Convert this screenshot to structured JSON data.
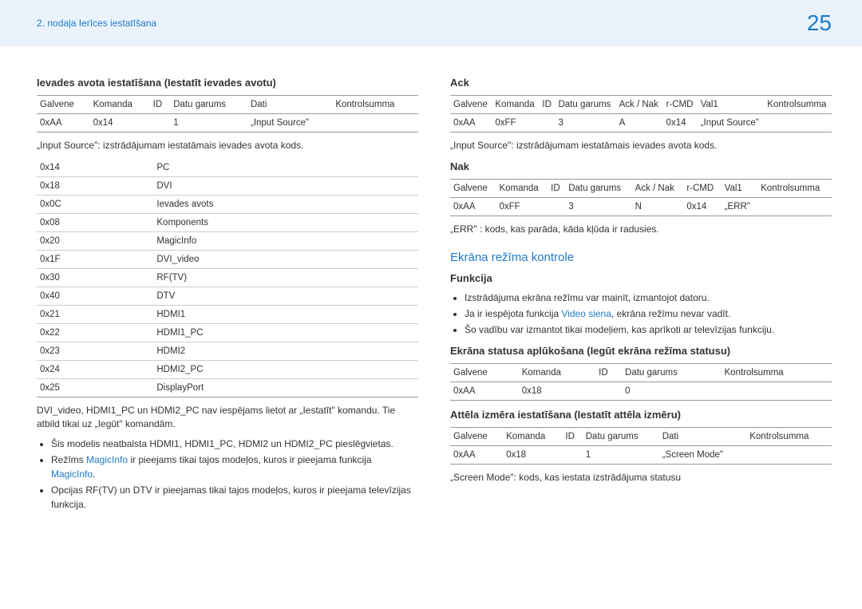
{
  "header": {
    "chapter": "2. nodaļa Ierīces iestatīšana",
    "page": "25"
  },
  "left": {
    "h1": "Ievades avota iestatīšana (Iestatīt ievades avotu)",
    "t1h": [
      "Galvene",
      "Komanda",
      "ID",
      "Datu garums",
      "Dati",
      "Kontrolsumma"
    ],
    "t1r": [
      "0xAA",
      "0x14",
      "",
      "1",
      "„Input Source\"",
      ""
    ],
    "note1": "„Input Source\": izstrādājumam iestatāmais ievades avota kods.",
    "t2": [
      [
        "0x14",
        "PC"
      ],
      [
        "0x18",
        "DVI"
      ],
      [
        "0x0C",
        "Ievades avots"
      ],
      [
        "0x08",
        "Komponents"
      ],
      [
        "0x20",
        "MagicInfo"
      ],
      [
        "0x1F",
        "DVI_video"
      ],
      [
        "0x30",
        "RF(TV)"
      ],
      [
        "0x40",
        "DTV"
      ],
      [
        "0x21",
        "HDMI1"
      ],
      [
        "0x22",
        "HDMI1_PC"
      ],
      [
        "0x23",
        "HDMI2"
      ],
      [
        "0x24",
        "HDMI2_PC"
      ],
      [
        "0x25",
        "DisplayPort"
      ]
    ],
    "note2": "DVI_video, HDMI1_PC un HDMI2_PC nav iespējams lietot ar „Iestatīt\" komandu. Tie atbild tikai uz „Iegūt\" komandām.",
    "bullets": {
      "b1": "Šis modelis neatbalsta HDMI1, HDMI1_PC, HDMI2 un HDMI2_PC pieslēgvietas.",
      "b2a": "Režīms ",
      "b2link": "MagicInfo",
      "b2b": " ir pieejams tikai tajos modeļos, kuros ir pieejama funkcija ",
      "b2link2": "MagicInfo",
      "b2c": ".",
      "b3": "Opcijas RF(TV) un DTV ir pieejamas tikai tajos modeļos, kuros ir pieejama televīzijas funkcija."
    }
  },
  "right": {
    "ack": "Ack",
    "ackH": [
      "Galvene",
      "Komanda",
      "ID",
      "Datu garums",
      "Ack / Nak",
      "r-CMD",
      "Val1",
      "Kontrolsumma"
    ],
    "ackR": [
      "0xAA",
      "0xFF",
      "",
      "3",
      "A",
      "0x14",
      "„Input Source\"",
      ""
    ],
    "ackNote": "„Input Source\": izstrādājumam iestatāmais ievades avota kods.",
    "nak": "Nak",
    "nakH": [
      "Galvene",
      "Komanda",
      "ID",
      "Datu garums",
      "Ack / Nak",
      "r-CMD",
      "Val1",
      "Kontrolsumma"
    ],
    "nakR": [
      "0xAA",
      "0xFF",
      "",
      "3",
      "N",
      "0x14",
      "„ERR\"",
      ""
    ],
    "nakNote": "„ERR\" : kods, kas parāda, kāda kļūda ir radusies.",
    "h2": "Ekrāna režīma kontrole",
    "h3": "Funkcija",
    "fb": {
      "f1": "Izstrādājuma ekrāna režīmu var mainīt, izmantojot datoru.",
      "f2a": "Ja ir iespējota funkcija ",
      "f2link": "Video siena",
      "f2b": ", ekrāna režīmu nevar vadīt.",
      "f3": "Šo vadību var izmantot tikai modeļiem, kas aprīkoti ar televīzijas funkciju."
    },
    "h4": "Ekrāna statusa aplūkošana (Iegūt ekrāna režīma statusu)",
    "t3h": [
      "Galvene",
      "Komanda",
      "ID",
      "Datu garums",
      "Kontrolsumma"
    ],
    "t3r": [
      "0xAA",
      "0x18",
      "",
      "0",
      ""
    ],
    "h5": "Attēla izmēra iestatīšana (Iestatīt attēla izmēru)",
    "t4h": [
      "Galvene",
      "Komanda",
      "ID",
      "Datu garums",
      "Dati",
      "Kontrolsumma"
    ],
    "t4r": [
      "0xAA",
      "0x18",
      "",
      "1",
      "„Screen Mode\"",
      ""
    ],
    "note3": "„Screen Mode\": kods, kas iestata izstrādājuma statusu"
  }
}
